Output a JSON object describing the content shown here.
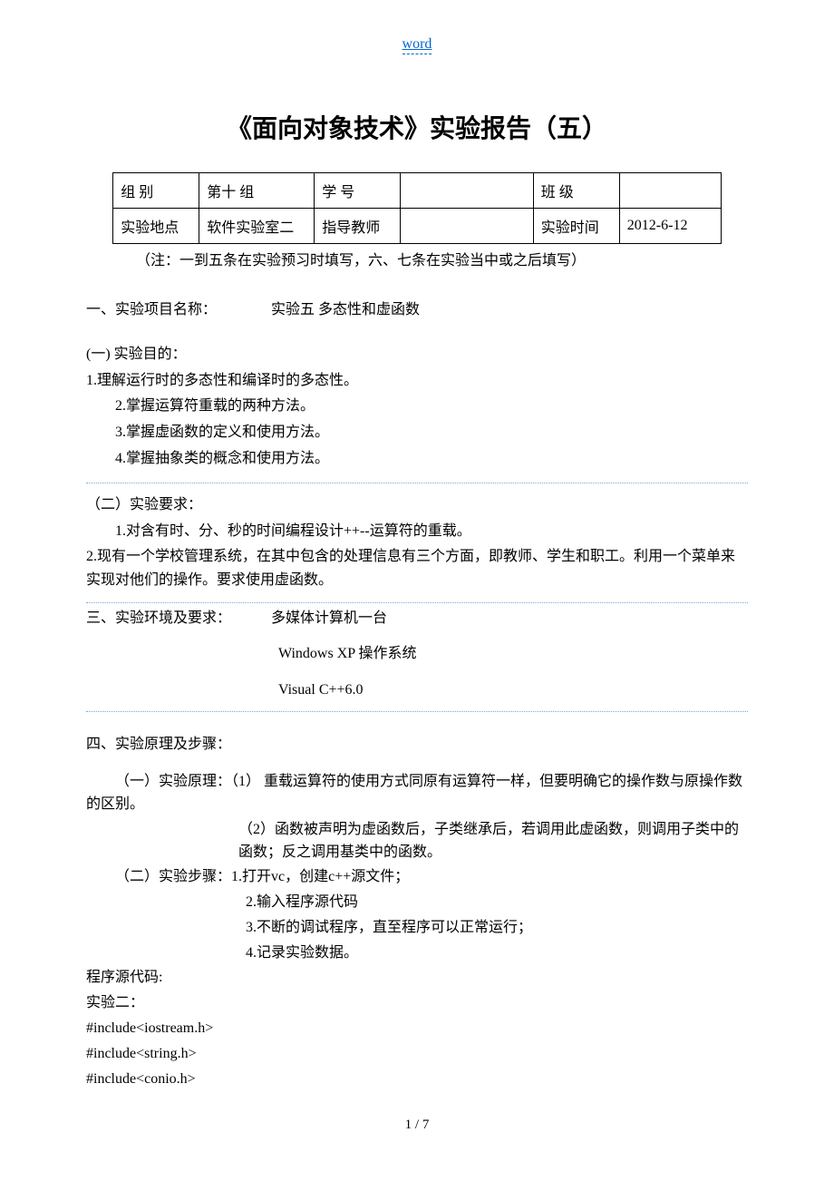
{
  "header_link": "word",
  "title": "《面向对象技术》实验报告（五）",
  "table": {
    "r1c1": "组 别",
    "r1c2": "第十 组",
    "r1c3": "学  号",
    "r1c4": "",
    "r1c5": "班  级",
    "r1c6": "",
    "r2c1": "实验地点",
    "r2c2": "软件实验室二",
    "r2c3": "指导教师",
    "r2c4": "",
    "r2c5": "实验时间",
    "r2c6": "2012-6-12"
  },
  "note": "（注：一到五条在实验预习时填写，六、七条在实验当中或之后填写）",
  "sec1": {
    "label": "一、实验项目名称：",
    "value": "实验五  多态性和虚函数"
  },
  "sec_a_title": "(一)  实验目的：",
  "sec_a_items": {
    "i1": "1.理解运行时的多态性和编译时的多态性。",
    "i2": "2.掌握运算符重载的两种方法。",
    "i3": "3.掌握虚函数的定义和使用方法。",
    "i4": "4.掌握抽象类的概念和使用方法。"
  },
  "sec_b_title": "（二）实验要求：",
  "sec_b_items": {
    "i1": "1.对含有时、分、秒的时间编程设计++--运算符的重载。",
    "i2": "2.现有一个学校管理系统，在其中包含的处理信息有三个方面，即教师、学生和职工。利用一个菜单来实现对他们的操作。要求使用虚函数。"
  },
  "sec3": {
    "label": "三、实验环境及要求：",
    "l1": "多媒体计算机一台",
    "l2": "Windows XP 操作系统",
    "l3": "Visual C++6.0"
  },
  "sec4_title": "四、实验原理及步骤：",
  "sec4": {
    "p1": "（一）实验原理：（1） 重载运算符的使用方式同原有运算符一样，但要明确它的操作数与原操作数的区别。",
    "p2": "（2）函数被声明为虚函数后，子类继承后，若调用此虚函数，则调用子类中的函数；反之调用基类中的函数。",
    "p3": "（二）实验步骤：1.打开vc，创建c++源文件；",
    "p4": "2.输入程序源代码",
    "p5": "3.不断的调试程序，直至程序可以正常运行；",
    "p6": "4.记录实验数据。"
  },
  "code": {
    "c1": "程序源代码:",
    "c2": "实验二：",
    "c3": "#include<iostream.h>",
    "c4": "#include<string.h>",
    "c5": "#include<conio.h>"
  },
  "page_num": "1 / 7"
}
